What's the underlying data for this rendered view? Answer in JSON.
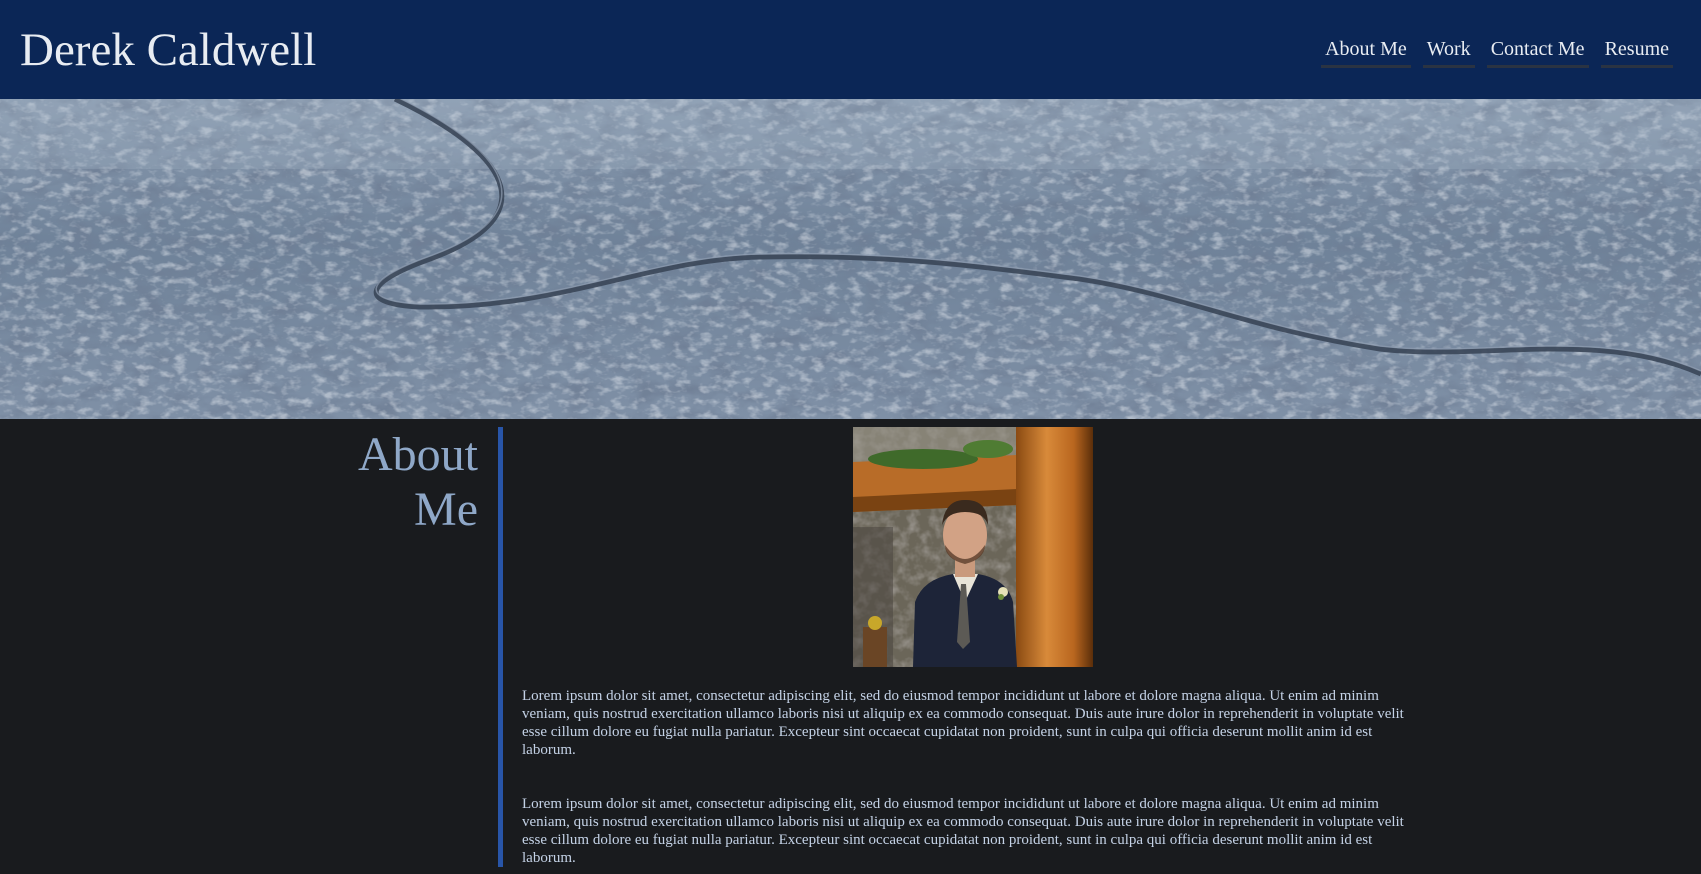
{
  "header": {
    "site_title": "Derek Caldwell",
    "nav": [
      {
        "label": "About Me"
      },
      {
        "label": "Work"
      },
      {
        "label": "Contact Me"
      },
      {
        "label": "Resume"
      }
    ]
  },
  "about": {
    "heading_line1": "About",
    "heading_line2": "Me",
    "paragraphs": [
      "Lorem ipsum dolor sit amet, consectetur adipiscing elit, sed do eiusmod tempor incididunt ut labore et dolore magna aliqua. Ut enim ad minim veniam, quis nostrud exercitation ullamco laboris nisi ut aliquip ex ea commodo consequat. Duis aute irure dolor in reprehenderit in voluptate velit esse cillum dolore eu fugiat nulla pariatur. Excepteur sint occaecat cupidatat non proident, sunt in culpa qui officia deserunt mollit anim id est laborum.",
      "Lorem ipsum dolor sit amet, consectetur adipiscing elit, sed do eiusmod tempor incididunt ut labore et dolore magna aliqua. Ut enim ad minim veniam, quis nostrud exercitation ullamco laboris nisi ut aliquip ex ea commodo consequat. Duis aute irure dolor in reprehenderit in voluptate velit esse cillum dolore eu fugiat nulla pariatur. Excepteur sint occaecat cupidatat non proident, sunt in culpa qui officia deserunt mollit anim id est laborum."
    ]
  },
  "colors": {
    "header_bg": "#0b2656",
    "page_bg": "#191b1e",
    "accent": "#2855a8",
    "heading": "#8fa8c8",
    "body_text": "#c4d2e6"
  }
}
